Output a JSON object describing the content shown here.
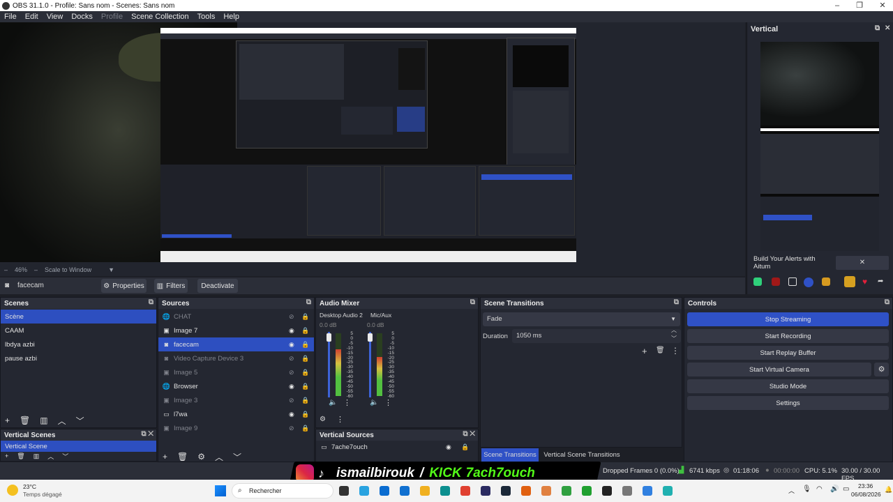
{
  "window": {
    "title": "OBS 31.1.0 - Profile: Sans nom - Scenes: Sans nom"
  },
  "menu": {
    "file": "File",
    "edit": "Edit",
    "view": "View",
    "docks": "Docks",
    "profile": "Profile",
    "scene_collection": "Scene Collection",
    "tools": "Tools",
    "help": "Help"
  },
  "preview": {
    "zoom": "46%",
    "scale": "Scale to Window"
  },
  "vertical_panel": {
    "title": "Vertical",
    "alert_banner": "Build Your Alerts with Aitum"
  },
  "source_bar": {
    "source": "facecam",
    "properties": "Properties",
    "filters": "Filters",
    "deactivate": "Deactivate"
  },
  "scenes": {
    "title": "Scenes",
    "items": [
      "Scène",
      "CAAM",
      "lbdya azbi",
      "pause azbi"
    ],
    "selected": 0
  },
  "vertical_scenes": {
    "title": "Vertical Scenes",
    "items": [
      "Vertical Scene"
    ]
  },
  "sources": {
    "title": "Sources",
    "items": [
      {
        "name": "CHAT",
        "icon": "globe-icon",
        "visible": false
      },
      {
        "name": "Image 7",
        "icon": "image-icon",
        "visible": true
      },
      {
        "name": "facecam",
        "icon": "camera-icon",
        "visible": true,
        "selected": true
      },
      {
        "name": "Video Capture Device 3",
        "icon": "camera-icon",
        "visible": false
      },
      {
        "name": "Image 5",
        "icon": "image-icon",
        "visible": false
      },
      {
        "name": "Browser",
        "icon": "globe-icon",
        "visible": true
      },
      {
        "name": "Image 3",
        "icon": "image-icon",
        "visible": false
      },
      {
        "name": "l7wa",
        "icon": "window-icon",
        "visible": true
      },
      {
        "name": "Image 9",
        "icon": "image-icon",
        "visible": false
      }
    ]
  },
  "audio_mixer": {
    "title": "Audio Mixer",
    "channels": [
      {
        "name": "Desktop Audio 2",
        "db": "0.0 dB",
        "level": 0.75
      },
      {
        "name": "Mic/Aux",
        "db": "0.0 dB",
        "level": 0.62
      }
    ],
    "scale": [
      "5",
      "0",
      "-5",
      "-10",
      "-15",
      "-20",
      "-25",
      "-30",
      "-35",
      "-40",
      "-45",
      "-50",
      "-55",
      "-60"
    ]
  },
  "vertical_sources": {
    "title": "Vertical Sources",
    "items": [
      "7ache7ouch"
    ]
  },
  "scene_transitions": {
    "title": "Scene Transitions",
    "transition": "Fade",
    "duration_label": "Duration",
    "duration": "1050 ms",
    "tab1": "Scene Transitions",
    "tab2": "Vertical Scene Transitions"
  },
  "controls": {
    "title": "Controls",
    "stop_streaming": "Stop Streaming",
    "start_recording": "Start Recording",
    "start_replay": "Start Replay Buffer",
    "start_virtual_camera": "Start Virtual Camera",
    "studio_mode": "Studio Mode",
    "settings": "Settings"
  },
  "overlay": {
    "handle": "ismailbirouk",
    "kick": "KICK",
    "kick_name": "7ach7ouch"
  },
  "status": {
    "dropped": "Dropped Frames 0 (0.0%)",
    "bitrate": "6741 kbps",
    "stream_time": "01:18:06",
    "rec_time": "00:00:00",
    "cpu": "CPU: 5.1%",
    "fps": "30.00 / 30.00 FPS"
  },
  "taskbar": {
    "weather_temp": "23°C",
    "weather_desc": "Temps dégagé",
    "search": "Rechercher",
    "time": "23:36",
    "date": "06/08/2026"
  },
  "colors": {
    "accent": "#2f51c6",
    "panel": "#242731",
    "kick_green": "#53fc18"
  }
}
